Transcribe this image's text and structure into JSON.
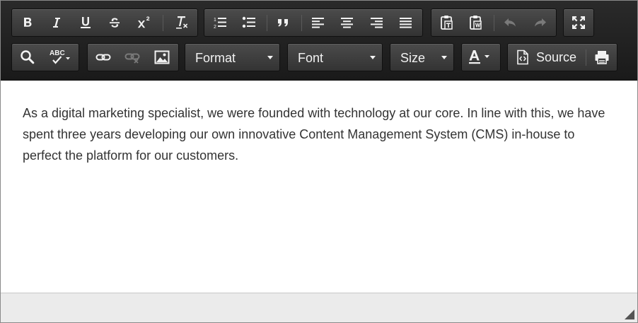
{
  "toolbar": {
    "format_label": "Format",
    "font_label": "Font",
    "size_label": "Size",
    "source_label": "Source"
  },
  "content": {
    "paragraph": "As a digital marketing specialist, we were founded with technology at our core. In line with this, we have spent three years developing our own innovative Content Management System (CMS) in-house to perfect the platform for our customers."
  },
  "icons": {
    "color": "#f2f2f2",
    "disabled_color": "#7a7a7a"
  }
}
